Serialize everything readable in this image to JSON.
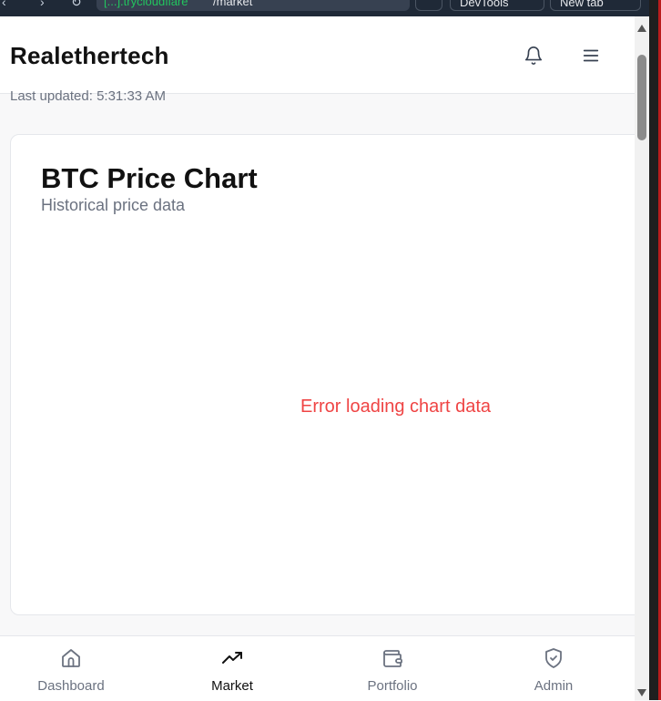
{
  "browser": {
    "url_host": "[...].trycloudflare",
    "url_path": "/market",
    "devtools_label": "DevTools",
    "new_tab_label": "New tab"
  },
  "header": {
    "brand": "Realethertech",
    "notifications_icon": "bell-icon",
    "menu_icon": "hamburger-menu-icon"
  },
  "status": {
    "last_updated": "Last updated: 5:31:33 AM"
  },
  "chart_card": {
    "title": "BTC Price Chart",
    "subtitle": "Historical price data",
    "error": "Error loading chart data",
    "error_color": "#ef4444"
  },
  "bottom_nav": {
    "items": [
      {
        "label": "Dashboard",
        "icon": "home-icon",
        "active": false
      },
      {
        "label": "Market",
        "icon": "trending-up-icon",
        "active": true
      },
      {
        "label": "Portfolio",
        "icon": "wallet-icon",
        "active": false
      },
      {
        "label": "Admin",
        "icon": "shield-check-icon",
        "active": false
      }
    ]
  }
}
